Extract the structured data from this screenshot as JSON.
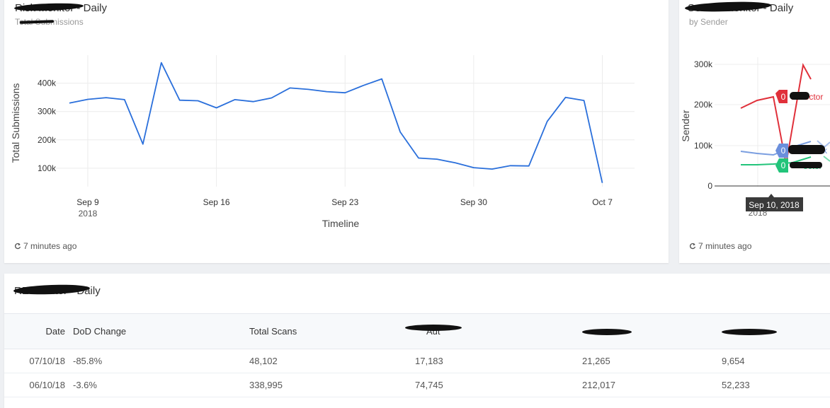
{
  "main_card": {
    "title": "Risk Monitor - Daily",
    "subtitle": "Total Submissions",
    "footer": "7 minutes ago"
  },
  "side_card": {
    "title": "Sender Monitor - Daily",
    "subtitle": "by Sender",
    "footer": "7 minutes ago",
    "tooltip": "Sep 10, 2018",
    "ylabel": "Sender",
    "xtick_year": "2018",
    "yticks": [
      "300k",
      "200k",
      "100k",
      "0"
    ],
    "series_tags": [
      {
        "badge": "0",
        "text": "Detector",
        "color": "#e0303a"
      },
      {
        "badge": "0",
        "text": "k",
        "color": "#6b8fdc"
      },
      {
        "badge": "0",
        "text": "ector",
        "color": "#22c47a"
      }
    ]
  },
  "table_card": {
    "title": "RE Monitor - Daily",
    "columns": [
      "Date",
      "DoD Change",
      "Total Scans",
      "Aut",
      "",
      ""
    ],
    "rows": [
      [
        "07/10/18",
        "-85.8%",
        "48,102",
        "17,183",
        "21,265",
        "9,654"
      ],
      [
        "06/10/18",
        "-3.6%",
        "338,995",
        "74,745",
        "212,017",
        "52,233"
      ]
    ]
  },
  "chart_data": {
    "type": "line",
    "title": "",
    "xlabel": "Timeline",
    "ylabel": "Total Submissions",
    "x_ticks": [
      "Sep 9\n2018",
      "Sep 16",
      "Sep 23",
      "Sep 30",
      "Oct 7"
    ],
    "y_ticks": [
      "100k",
      "200k",
      "300k",
      "400k"
    ],
    "ylim": [
      60000,
      500000
    ],
    "grid": true,
    "x": [
      "2018-09-08",
      "2018-09-09",
      "2018-09-10",
      "2018-09-11",
      "2018-09-12",
      "2018-09-13",
      "2018-09-14",
      "2018-09-15",
      "2018-09-16",
      "2018-09-17",
      "2018-09-18",
      "2018-09-19",
      "2018-09-20",
      "2018-09-21",
      "2018-09-22",
      "2018-09-23",
      "2018-09-24",
      "2018-09-25",
      "2018-09-26",
      "2018-09-27",
      "2018-09-28",
      "2018-09-29",
      "2018-09-30",
      "2018-10-01",
      "2018-10-02",
      "2018-10-03",
      "2018-10-04",
      "2018-10-05",
      "2018-10-06",
      "2018-10-07"
    ],
    "series": [
      {
        "color": "#2a6fdb",
        "values": [
          330000,
          343000,
          349000,
          342000,
          185000,
          472000,
          340000,
          338000,
          313000,
          342000,
          335000,
          348000,
          383000,
          378000,
          370000,
          366000,
          392000,
          415000,
          228000,
          136000,
          132000,
          119000,
          102000,
          97000,
          109000,
          108000,
          265000,
          350000,
          339000,
          48102
        ]
      }
    ]
  }
}
